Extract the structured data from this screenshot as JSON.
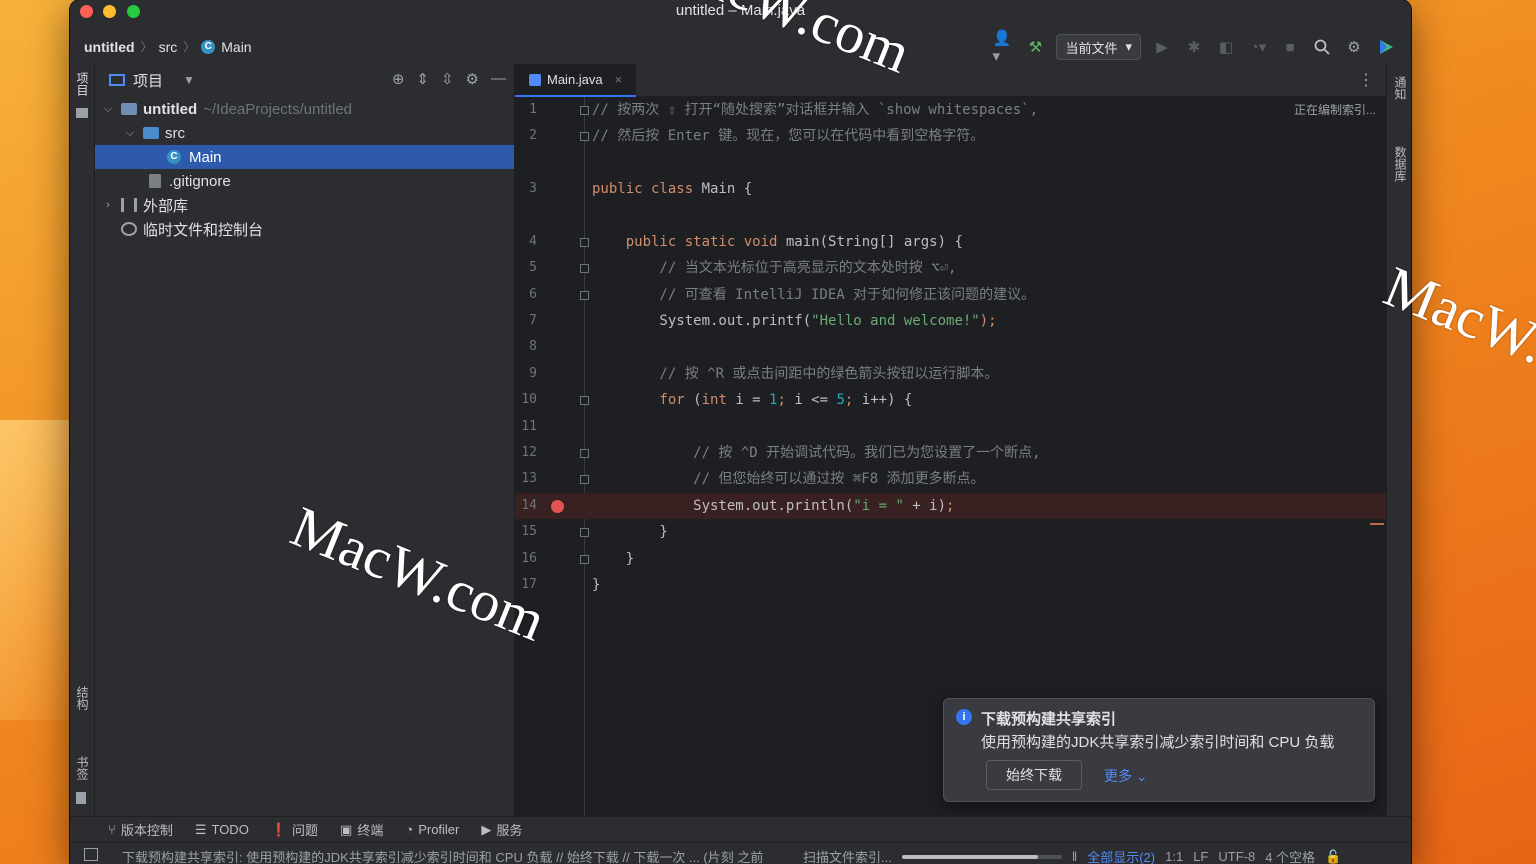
{
  "window": {
    "title": "untitled – Main.java"
  },
  "breadcrumb": {
    "project": "untitled",
    "folder": "src",
    "file": "Main",
    "file_badge": "C"
  },
  "toolbar": {
    "run_config": "当前文件"
  },
  "left_stripe": {
    "project_label": "项目",
    "structure_label": "结构",
    "bookmarks_label": "书签"
  },
  "right_stripe": {
    "notifications_label": "通知",
    "database_label": "数据库"
  },
  "project_panel": {
    "title": "项目",
    "tree": [
      {
        "name": "untitled",
        "path": "~/IdeaProjects/untitled"
      },
      {
        "name": "src"
      },
      {
        "name": "Main"
      },
      {
        "name": ".gitignore"
      },
      {
        "name": "外部库"
      },
      {
        "name": "临时文件和控制台"
      }
    ]
  },
  "editor": {
    "tab": "Main.java",
    "indexing": "正在编制索引...",
    "lines": [
      {
        "n": "1",
        "segs": [
          {
            "t": "// 按两次 ⇧ 打开“随处搜索”对话框并输入 `show whitespaces`,",
            "c": "cm"
          }
        ]
      },
      {
        "n": "2",
        "segs": [
          {
            "t": "// 然后按 Enter 键。现在，您可以在代码中看到空格字符。",
            "c": "cm"
          }
        ]
      },
      {
        "n": "3",
        "segs": [
          {
            "t": "public class ",
            "c": "kw"
          },
          {
            "t": "Main {",
            "c": ""
          }
        ]
      },
      {
        "n": "4",
        "segs": [
          {
            "t": "    public static void ",
            "c": "kw"
          },
          {
            "t": "main(String[] args) {",
            "c": ""
          }
        ]
      },
      {
        "n": "5",
        "segs": [
          {
            "t": "        // 当文本光标位于高亮显示的文本处时按 ⌥⏎,",
            "c": "cm"
          }
        ]
      },
      {
        "n": "6",
        "segs": [
          {
            "t": "        // 可查看 IntelliJ IDEA 对于如何修正该问题的建议。",
            "c": "cm"
          }
        ]
      },
      {
        "n": "7",
        "segs": [
          {
            "t": "        System.out.printf(",
            "c": ""
          },
          {
            "t": "\"Hello and welcome!\"",
            "c": "st"
          },
          {
            "t": ");",
            "c": "kw"
          }
        ]
      },
      {
        "n": "8",
        "segs": [
          {
            "t": "",
            "c": ""
          }
        ]
      },
      {
        "n": "9",
        "segs": [
          {
            "t": "        // 按 ^R 或点击间距中的绿色箭头按钮以运行脚本。",
            "c": "cm"
          }
        ]
      },
      {
        "n": "10",
        "segs": [
          {
            "t": "        for ",
            "c": "kw"
          },
          {
            "t": "(",
            "c": ""
          },
          {
            "t": "int ",
            "c": "kw"
          },
          {
            "t": "i = ",
            "c": ""
          },
          {
            "t": "1",
            "c": "nm"
          },
          {
            "t": "; ",
            "c": "kw"
          },
          {
            "t": "i <= ",
            "c": ""
          },
          {
            "t": "5",
            "c": "nm"
          },
          {
            "t": "; ",
            "c": "kw"
          },
          {
            "t": "i++) {",
            "c": ""
          }
        ]
      },
      {
        "n": "11",
        "segs": [
          {
            "t": "",
            "c": ""
          }
        ]
      },
      {
        "n": "12",
        "segs": [
          {
            "t": "            // 按 ^D 开始调试代码。我们已为您设置了一个断点,",
            "c": "cm"
          }
        ]
      },
      {
        "n": "13",
        "segs": [
          {
            "t": "            // 但您始终可以通过按 ⌘F8 添加更多断点。",
            "c": "cm"
          }
        ]
      },
      {
        "n": "14",
        "segs": [
          {
            "t": "            System.out.println(",
            "c": ""
          },
          {
            "t": "\"i = \"",
            "c": "st"
          },
          {
            "t": " + i)",
            "c": ""
          },
          {
            "t": ";",
            "c": "kw"
          }
        ]
      },
      {
        "n": "15",
        "segs": [
          {
            "t": "        }",
            "c": ""
          }
        ]
      },
      {
        "n": "16",
        "segs": [
          {
            "t": "    }",
            "c": ""
          }
        ]
      },
      {
        "n": "17",
        "segs": [
          {
            "t": "}",
            "c": ""
          }
        ]
      }
    ]
  },
  "notification": {
    "title": "下载预构建共享索引",
    "body": "使用预构建的JDK共享索引减少索引时间和 CPU 负载",
    "primary_button": "始终下载",
    "more_link": "更多"
  },
  "bottom_tools": [
    {
      "icon": "vcs-icon",
      "glyph": "⑂",
      "label": "版本控制"
    },
    {
      "icon": "todo-icon",
      "glyph": "☰",
      "label": "TODO"
    },
    {
      "icon": "problems-icon",
      "glyph": "❗",
      "label": "问题"
    },
    {
      "icon": "terminal-icon",
      "glyph": "▣",
      "label": "终端"
    },
    {
      "icon": "profiler-icon",
      "glyph": "◔",
      "label": "Profiler"
    },
    {
      "icon": "services-icon",
      "glyph": "▶",
      "label": "服务"
    }
  ],
  "status_bar": {
    "message": "下载预构建共享索引: 使用预构建的JDK共享索引减少索引时间和 CPU 负载 // 始终下载 // 下载一次 ... (片刻 之前",
    "scan_text": "扫描文件索引...",
    "progress": 0.85,
    "show_all": "全部显示(2)",
    "position": "1:1",
    "line_sep": "LF",
    "encoding": "UTF-8",
    "indent": "4 个空格"
  },
  "watermark": "MacW.com",
  "colors": {
    "accent": "#3574f0",
    "selection": "#2e5aac",
    "breakpoint": "#e55353",
    "keyword": "#cf8e6d",
    "string": "#6aab73",
    "number": "#2aacb8",
    "comment": "#7a7e85"
  }
}
